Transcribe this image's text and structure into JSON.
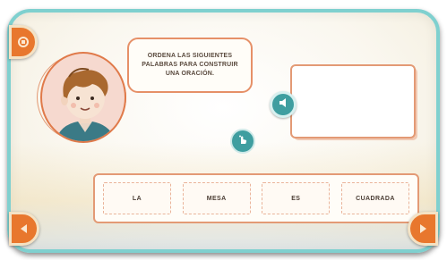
{
  "instruction": "ORDENA LAS SIGUIENTES PALABRAS PARA CONSTRUIR UNA ORACIÓN.",
  "answer_area": "",
  "words": [
    {
      "label": "LA"
    },
    {
      "label": "MESA"
    },
    {
      "label": "ES"
    },
    {
      "label": "CUADRADA"
    }
  ],
  "icons": {
    "top_left": "home-icon",
    "audio": "speaker-icon",
    "help": "hand-pointer-icon",
    "prev": "arrow-left-icon",
    "next": "arrow-right-icon"
  },
  "colors": {
    "frame_border": "#7fd0cf",
    "accent_orange": "#e8772d",
    "accent_teal": "#3f9ea0",
    "outline_salmon": "#e39a75"
  }
}
